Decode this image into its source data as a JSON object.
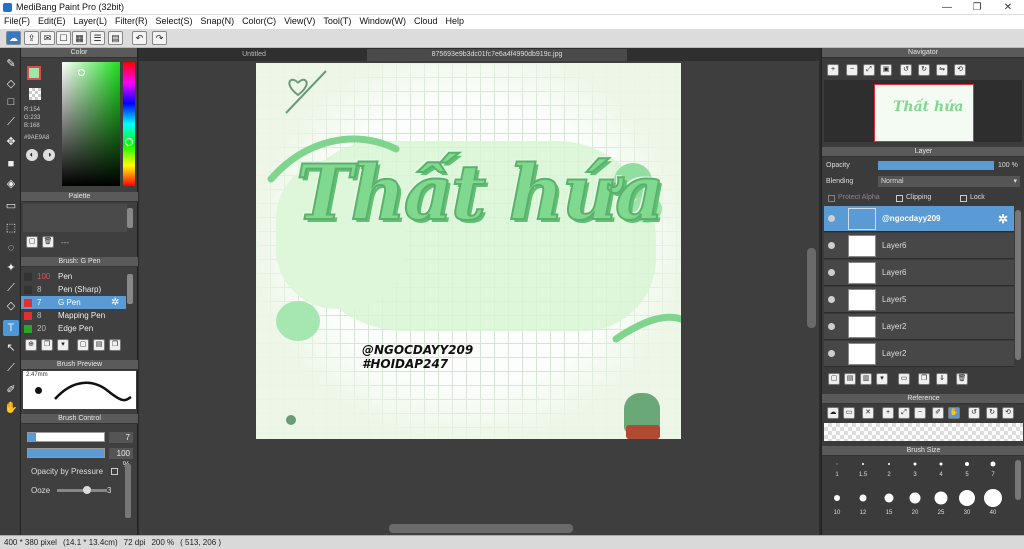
{
  "window": {
    "title": "MediBang Paint Pro (32bit)",
    "minimize": "—",
    "maximize": "❐",
    "close": "✕"
  },
  "menu": [
    "File(F)",
    "Edit(E)",
    "Layer(L)",
    "Filter(R)",
    "Select(S)",
    "Snap(N)",
    "Color(C)",
    "View(V)",
    "Tool(T)",
    "Window(W)",
    "Cloud",
    "Help"
  ],
  "color_panel": {
    "title": "Color",
    "r": "R:154",
    "g": "G:233",
    "b": "B:168",
    "hex": "#9AE9A8",
    "fg_color": "#9AE9A8"
  },
  "palette_panel": {
    "title": "Palette",
    "placeholder": "---"
  },
  "brush_panel": {
    "title": "Brush: G Pen",
    "brushes": [
      {
        "size": "100",
        "name": "Pen",
        "color": "#333333"
      },
      {
        "size": "8",
        "name": "Pen (Sharp)",
        "color": "#333333"
      },
      {
        "size": "7",
        "name": "G Pen",
        "color": "#e03030"
      },
      {
        "size": "8",
        "name": "Mapping Pen",
        "color": "#e03030"
      },
      {
        "size": "20",
        "name": "Edge Pen",
        "color": "#2aa52a"
      }
    ]
  },
  "brush_preview": {
    "title": "Brush Preview",
    "size": "2.47mm"
  },
  "brush_control": {
    "title": "Brush Control",
    "size_value": "7",
    "opacity_value": "100 %",
    "opacity_pressure": "Opacity by Pressure",
    "ooze_label": "Ooze",
    "ooze_value": "3",
    "ooze_level": 0.6
  },
  "tabs": [
    "Untitled",
    "875693e9b3dc01fc7e6a4f4990db919c.jpg"
  ],
  "artwork": {
    "main_text": "Thất hứa",
    "handle": "@NGOCDAYY209",
    "hashtag": "#HOIDAP247"
  },
  "navigator": {
    "title": "Navigator",
    "buttons": [
      "zoom-in",
      "zoom-out",
      "fit",
      "actual",
      "rotate-left",
      "rotate-right",
      "flip",
      "reset"
    ]
  },
  "layer_panel": {
    "title": "Layer",
    "opacity_label": "Opacity",
    "opacity_value": "100 %",
    "blending_label": "Blending",
    "blending_value": "Normal",
    "protect_alpha": "Protect Alpha",
    "clipping": "Clipping",
    "lock": "Lock",
    "layers": [
      {
        "name": "@ngocdayy209",
        "selected": true
      },
      {
        "name": "Layer6",
        "selected": false
      },
      {
        "name": "Layer6",
        "selected": false
      },
      {
        "name": "Layer5",
        "selected": false
      },
      {
        "name": "Layer2",
        "selected": false
      },
      {
        "name": "Layer2",
        "selected": false
      }
    ]
  },
  "reference_panel": {
    "title": "Reference"
  },
  "brush_size_panel": {
    "title": "Brush Size",
    "sizes": [
      "1",
      "1.5",
      "2",
      "3",
      "4",
      "5",
      "7",
      "10",
      "12",
      "15",
      "20",
      "25",
      "30",
      "40"
    ]
  },
  "status": {
    "dimensions": "400 * 380 pixel",
    "physical": "(14.1 * 13.4cm)",
    "dpi": "72 dpi",
    "zoom": "200 %",
    "coords": "( 513, 206 )"
  }
}
